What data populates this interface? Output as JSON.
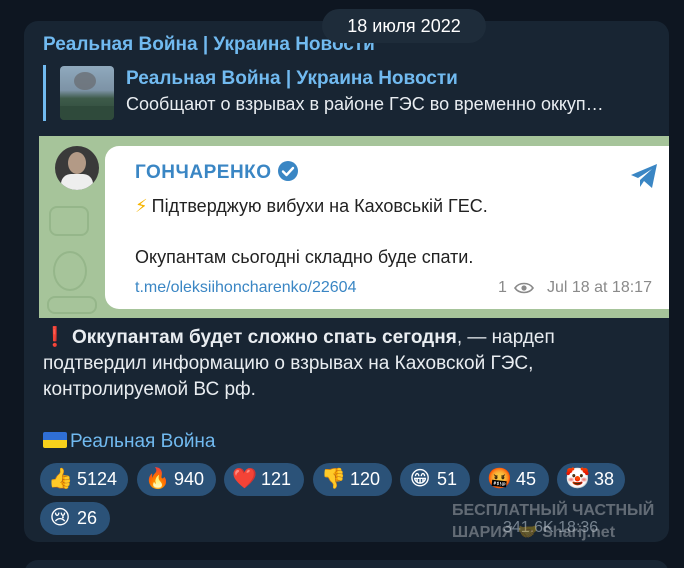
{
  "date_pill": "18 июля 2022",
  "channel": {
    "name": "Реальная Война | Украина Новости"
  },
  "reply": {
    "title": "Реальная Война | Украина Новости",
    "text": "Сообщают о взрывах в районе ГЭС во временно оккуп…"
  },
  "embed": {
    "author": "ГОНЧАРЕНКО",
    "bolt": "⚡",
    "line1": "Підтверджую вибухи на Каховській ГЕС.",
    "line2": "Окупантам сьогодні складно буде спати.",
    "link": "t.me/oleksiihoncharenko/22604",
    "views": "1",
    "time": "Jul 18 at 18:17"
  },
  "message": {
    "exclaim": "❗",
    "bold": "Оккупантам будет сложно спать сегодня",
    "rest": ", — нардеп подтвердил информацию о взрывах на Каховской ГЭС, контролируемой ВС рф."
  },
  "signature": "Реальная Война",
  "reactions": [
    {
      "emoji": "👍",
      "count": "5124"
    },
    {
      "emoji": "🔥",
      "count": "940"
    },
    {
      "emoji": "❤️",
      "count": "121"
    },
    {
      "emoji": "👎",
      "count": "120"
    },
    {
      "emoji": "😁",
      "count": "51"
    },
    {
      "emoji": "🤬",
      "count": "45"
    },
    {
      "emoji": "🤡",
      "count": "38"
    },
    {
      "emoji": "😢",
      "count": "26"
    }
  ],
  "watermark": {
    "line1": "БЕСПЛАТНЫЙ ЧАСТНЫЙ",
    "line2": "ШАРИЯ 🤝 Sharij.net"
  },
  "post_meta": "341.6K 18:36",
  "colors": {
    "background": "#0e1621",
    "bubble": "#182533",
    "accent": "#71baf0",
    "reaction": "#2b5278"
  }
}
